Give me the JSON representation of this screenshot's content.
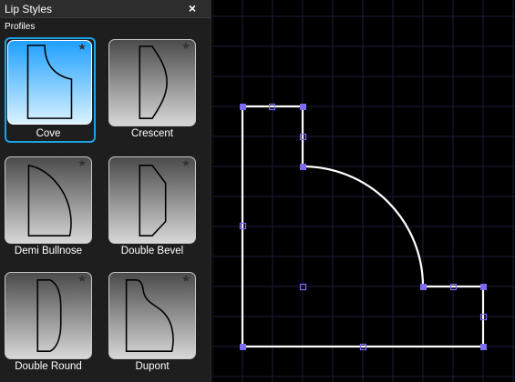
{
  "panel": {
    "title": "Lip Styles",
    "close_glyph": "×",
    "section_label": "Profiles",
    "favorite_glyph": "★",
    "profiles": [
      {
        "label": "Cove",
        "selected": true,
        "shape": "cove"
      },
      {
        "label": "Crescent",
        "selected": false,
        "shape": "crescent"
      },
      {
        "label": "Demi Bullnose",
        "selected": false,
        "shape": "demi-bullnose"
      },
      {
        "label": "Double Bevel",
        "selected": false,
        "shape": "double-bevel"
      },
      {
        "label": "Double Round",
        "selected": false,
        "shape": "double-round"
      },
      {
        "label": "Dupont",
        "selected": false,
        "shape": "dupont"
      }
    ]
  },
  "colors": {
    "canvas_background": "#000000",
    "grid_line": "#1c1c38",
    "profile_line": "#ffffff",
    "handle": "#7b6cf0",
    "selection_accent": "#1aa3e8"
  }
}
